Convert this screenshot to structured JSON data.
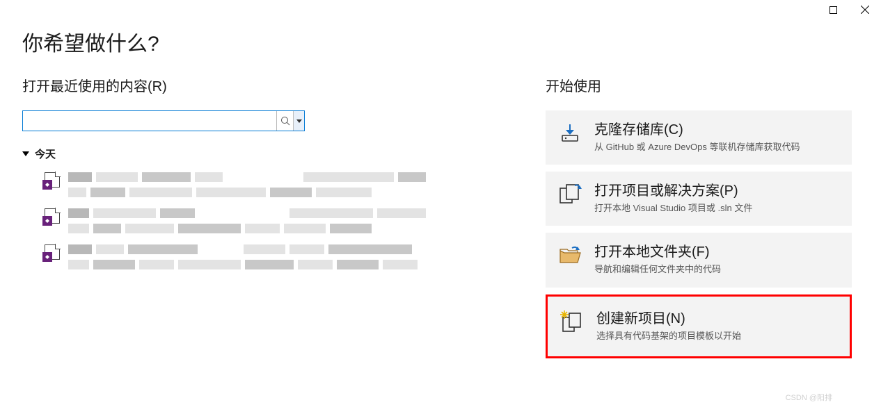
{
  "window": {
    "title": "你希望做什么?"
  },
  "left": {
    "heading": "打开最近使用的内容(R)",
    "search_value": "",
    "group_label": "今天"
  },
  "right": {
    "heading": "开始使用",
    "cards": [
      {
        "title": "克隆存储库(C)",
        "desc": "从 GitHub 或 Azure DevOps 等联机存储库获取代码"
      },
      {
        "title": "打开项目或解决方案(P)",
        "desc": "打开本地 Visual Studio 项目或 .sln 文件"
      },
      {
        "title": "打开本地文件夹(F)",
        "desc": "导航和编辑任何文件夹中的代码"
      },
      {
        "title": "创建新项目(N)",
        "desc": "选择具有代码基架的项目模板以开始"
      }
    ]
  },
  "watermark": "CSDN @阳排"
}
